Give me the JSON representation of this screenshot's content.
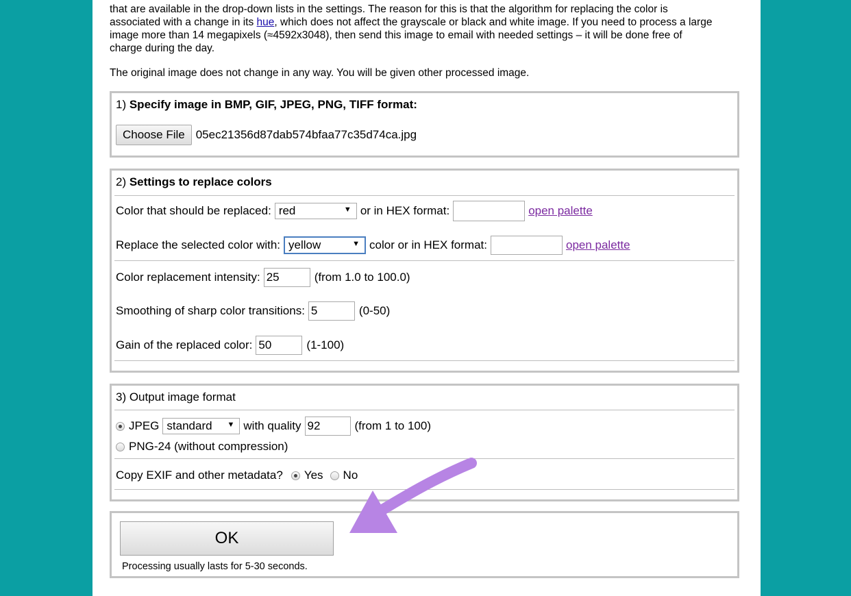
{
  "intro": {
    "line1": "that are available in the drop-down lists in the settings. The reason for this is that the algorithm for replacing the color is",
    "line2_a": "associated with a change in its ",
    "line2_link": "hue",
    "line2_b": ", which does not affect the grayscale or black and white image. If you need to process a large",
    "line3": "image more than 14 megapixels (≈4592x3048), then send this image to email with needed settings – it will be done free of",
    "line4": "charge during the day.",
    "note": "The original image does not change in any way. You will be given other processed image."
  },
  "section1": {
    "num": "1) ",
    "title": "Specify image in BMP, GIF, JPEG, PNG, TIFF format:",
    "choose_file_label": "Choose File",
    "file_name": "05ec21356d87dab574bfaa77c35d74ca.jpg"
  },
  "section2": {
    "num": "2) ",
    "title": "Settings to replace colors",
    "replace_label": "Color that should be replaced:",
    "replace_select": "red",
    "replace_hex_label": "or in HEX format:",
    "replace_hex_value": "",
    "open_palette_1": "open palette",
    "with_label": "Replace the selected color with:",
    "with_select": "yellow",
    "with_hex_label": "color or in HEX format:",
    "with_hex_value": "",
    "open_palette_2": "open palette",
    "intensity_label": "Color replacement intensity:",
    "intensity_value": "25",
    "intensity_range": "(from 1.0 to 100.0)",
    "smoothing_label": "Smoothing of sharp color transitions:",
    "smoothing_value": "5",
    "smoothing_range": "(0-50)",
    "gain_label": "Gain of the replaced color:",
    "gain_value": "50",
    "gain_range": "(1-100)"
  },
  "section3": {
    "title": "3) Output image format",
    "jpeg_label": "JPEG",
    "jpeg_select": "standard",
    "quality_label": "with quality",
    "quality_value": "92",
    "quality_range": "(from 1 to 100)",
    "png_label": "PNG-24 (without compression)",
    "exif_label": "Copy EXIF and other metadata?",
    "yes_label": "Yes",
    "no_label": "No"
  },
  "submit": {
    "ok_label": "OK",
    "processing_note": "Processing usually lasts for 5-30 seconds."
  },
  "colors": {
    "background": "#0b9fa3",
    "annotation_arrow": "#b784e4",
    "link_visited": "#7b2aa0",
    "link": "#1a0dab"
  },
  "icons": {
    "dropdown": "chevron-down-icon",
    "annotation": "arrow-annotation"
  }
}
